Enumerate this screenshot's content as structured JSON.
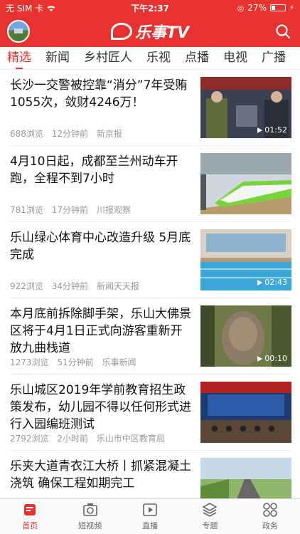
{
  "status": {
    "carrier": "无 SIM 卡",
    "time": "下午2:37",
    "battery": "27%",
    "battery_level": 0.27
  },
  "header": {
    "logo_text": "乐事TV"
  },
  "tabs": [
    {
      "label": "精选",
      "active": true
    },
    {
      "label": "新闻"
    },
    {
      "label": "乡村匠人"
    },
    {
      "label": "乐视"
    },
    {
      "label": "点播"
    },
    {
      "label": "电视"
    },
    {
      "label": "广播"
    }
  ],
  "feed": [
    {
      "title": "长沙一交警被控靠“消分”7年受贿1055次，敛财4246万！",
      "views": "688浏览",
      "time": "12分钟前",
      "source": "新京报",
      "duration": "01:52",
      "thumb": "court"
    },
    {
      "title": "4月10日起，成都至兰州动车开跑，全程不到7小时",
      "views": "781浏览",
      "time": "17分钟前",
      "source": "川报观察",
      "duration": "",
      "thumb": "train"
    },
    {
      "title": "乐山绿心体育中心改造升级 5月底完成",
      "views": "922浏览",
      "time": "34分钟前",
      "source": "新闻天天报",
      "duration": "02:43",
      "thumb": "pool"
    },
    {
      "title": "本月底前拆除脚手架，乐山大佛景区将于4月1日正式向游客重新开放九曲栈道",
      "views": "1273浏览",
      "time": "51分钟前",
      "source": "乐事新闻",
      "duration": "00:10",
      "thumb": "buddha"
    },
    {
      "title": "乐山城区2019年学前教育招生政策发布，幼儿园不得以任何形式进行入园编班测试",
      "views": "2792浏览",
      "time": "2小时前",
      "source": "乐山市中区教育局",
      "duration": "",
      "thumb": "meeting"
    },
    {
      "title": "乐夹大道青衣江大桥丨抓紧混凝土浇筑 确保工程如期完工",
      "views": "",
      "time": "",
      "source": "",
      "duration": "",
      "thumb": "road"
    }
  ],
  "bottomnav": [
    {
      "label": "首页",
      "icon": "home-icon",
      "active": true
    },
    {
      "label": "短视频",
      "icon": "camera-icon"
    },
    {
      "label": "直播",
      "icon": "play-icon"
    },
    {
      "label": "专题",
      "icon": "layers-icon"
    },
    {
      "label": "政务",
      "icon": "grid-icon"
    }
  ]
}
